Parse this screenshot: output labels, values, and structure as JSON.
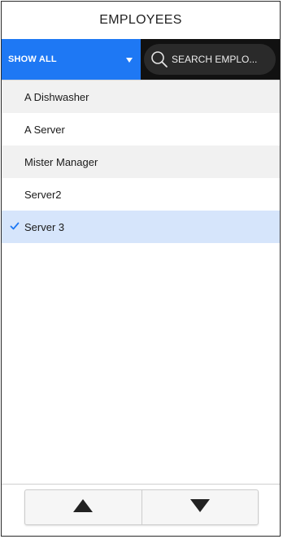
{
  "header": {
    "title": "EMPLOYEES"
  },
  "toolbar": {
    "filter_label": "SHOW ALL",
    "filter_icon": "caret-down-icon",
    "search_placeholder": "SEARCH EMPLO...",
    "search_icon": "search-icon"
  },
  "employees": [
    {
      "name": "A Dishwasher",
      "selected": false
    },
    {
      "name": "A Server",
      "selected": false
    },
    {
      "name": "Mister Manager",
      "selected": false
    },
    {
      "name": "Server2",
      "selected": false
    },
    {
      "name": "Server 3",
      "selected": true
    }
  ],
  "footer": {
    "up_icon": "triangle-up-icon",
    "down_icon": "triangle-down-icon"
  },
  "colors": {
    "accent": "#1e78f4",
    "selected_row": "#d6e5fb",
    "alt_row": "#f1f1f1",
    "search_bg": "#111111"
  }
}
